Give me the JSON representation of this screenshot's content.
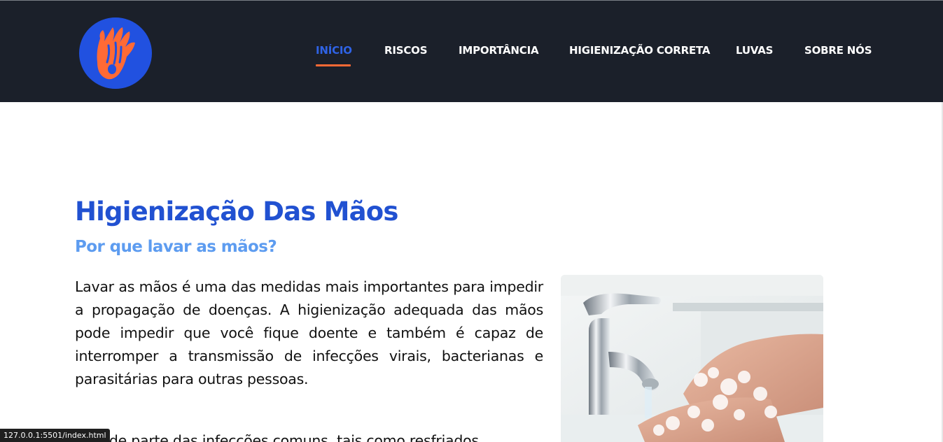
{
  "header": {
    "logo_icon": "hands-logo-icon",
    "colors": {
      "background": "#1b202a",
      "accent": "#ff6a35",
      "active": "#2f63e6",
      "logo_bg": "#2151e0"
    },
    "nav": [
      {
        "label": "INÍCIO",
        "active": true
      },
      {
        "label": "RISCOS",
        "active": false
      },
      {
        "label": "IMPORTÂNCIA",
        "active": false
      },
      {
        "label": "HIGIENIZAÇÃO CORRETA",
        "active": false
      },
      {
        "label": "LUVAS",
        "active": false
      },
      {
        "label": "SOBRE NÓS",
        "active": false
      }
    ]
  },
  "main": {
    "title": "Higienização Das Mãos",
    "subtitle": "Por que lavar as mãos?",
    "paragraphs": [
      "Lavar as mãos é uma das medidas mais importantes para impedir a propagação de doenças. A higienização adequada das mãos pode impedir que você fique doente e também é capaz de interromper a transmissão de infecções virais, bacterianas e parasitárias para outras pessoas.",
      "Grande parte das infecções comuns, tais como resfriados,"
    ],
    "image_icon": "handwashing-photo",
    "colors": {
      "title": "#2151d1",
      "subtitle": "#5d9cf0"
    }
  },
  "status_bar": {
    "url": "127.0.0.1:5501/index.html"
  }
}
